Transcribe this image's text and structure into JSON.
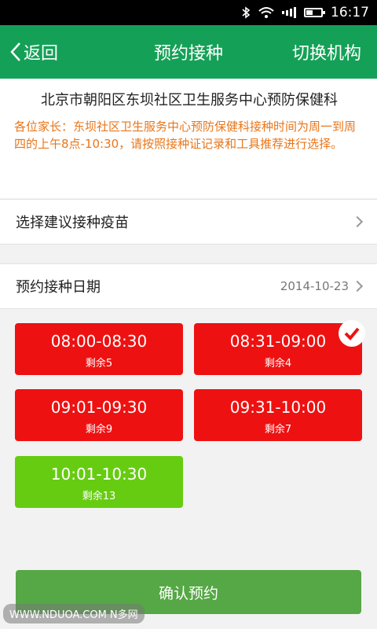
{
  "status": {
    "time": "16:17"
  },
  "nav": {
    "back": "返回",
    "title": "预约接种",
    "switch": "切换机构"
  },
  "info": {
    "title": "北京市朝阳区东坝社区卫生服务中心预防保健科",
    "notice": "各位家长：东坝社区卫生服务中心预防保健科接种时间为周一到周四的上午8点-10:30，请按照接种证记录和工具推荐进行选择。"
  },
  "vaccine_row": {
    "label": "选择建议接种疫苗"
  },
  "date_row": {
    "label": "预约接种日期",
    "value": "2014-10-23"
  },
  "slots": [
    {
      "time": "08:00-08:30",
      "remaining": "剩余5",
      "color": "#ee1111"
    },
    {
      "time": "08:31-09:00",
      "remaining": "剩余4",
      "color": "#ee1111",
      "selected": true
    },
    {
      "time": "09:01-09:30",
      "remaining": "剩余9",
      "color": "#ee1111"
    },
    {
      "time": "09:31-10:00",
      "remaining": "剩余7",
      "color": "#ee1111"
    },
    {
      "time": "10:01-10:30",
      "remaining": "剩余13",
      "color": "#66cc11"
    }
  ],
  "confirm": {
    "label": "确认预约"
  },
  "watermark": {
    "text": "WWW.NDUOA.COM N多网"
  }
}
